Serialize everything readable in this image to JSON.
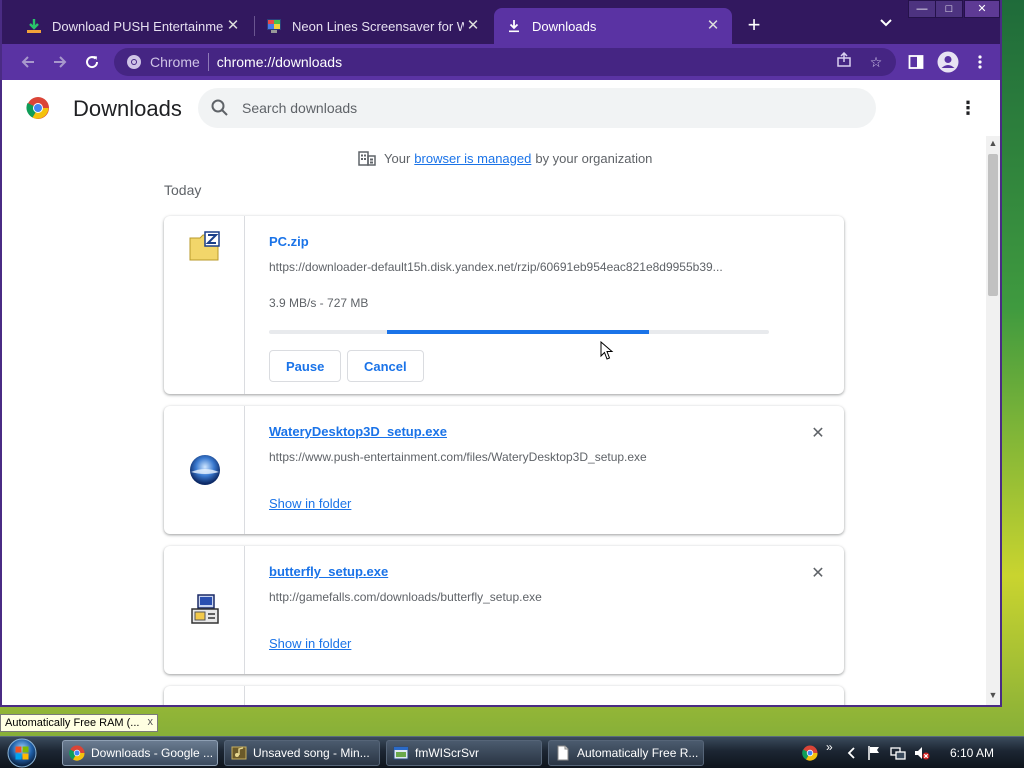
{
  "browser": {
    "tabs": [
      {
        "title": "Download PUSH Entertainment - ",
        "active": false
      },
      {
        "title": "Neon Lines Screensaver for Windo",
        "active": false
      },
      {
        "title": "Downloads",
        "active": true
      }
    ],
    "new_tab_label": "+",
    "window_controls": {
      "minimize": "—",
      "maximize": "□",
      "close": "✕"
    },
    "omnibox": {
      "scheme_label": "Chrome",
      "url": "chrome://downloads"
    }
  },
  "downloads_page": {
    "title": "Downloads",
    "search": {
      "placeholder": "Search downloads",
      "value": ""
    },
    "managed_notice": {
      "prefix": "Your",
      "link": "browser is managed",
      "suffix": "by your organization"
    },
    "date_group": "Today",
    "items": [
      {
        "name": "PC.zip",
        "url": "https://downloader-default15h.disk.yandex.net/rzip/60691eb954eac821e8d9955b39...",
        "status": "3.9 MB/s - 727 MB",
        "progress": 0.76,
        "buttons": {
          "pause": "Pause",
          "cancel": "Cancel"
        }
      },
      {
        "name": "WateryDesktop3D_setup.exe",
        "url": "https://www.push-entertainment.com/files/WateryDesktop3D_setup.exe",
        "action": "Show in folder"
      },
      {
        "name": "butterfly_setup.exe",
        "url": "http://gamefalls.com/downloads/butterfly_setup.exe",
        "action": "Show in folder"
      }
    ]
  },
  "gadget": {
    "label": "Automatically Free RAM (...",
    "close": "x"
  },
  "taskbar": {
    "items": [
      {
        "label": "Downloads - Google ...",
        "active": true
      },
      {
        "label": "Unsaved song - Min...",
        "active": false
      },
      {
        "label": "fmWIScrSvr",
        "active": false
      },
      {
        "label": "Automatically Free R...",
        "active": false
      }
    ],
    "clock": "6:10 AM"
  },
  "colors": {
    "tab_strip": "#32185f",
    "toolbar": "#5a33a3",
    "link_blue": "#1a73e8"
  }
}
